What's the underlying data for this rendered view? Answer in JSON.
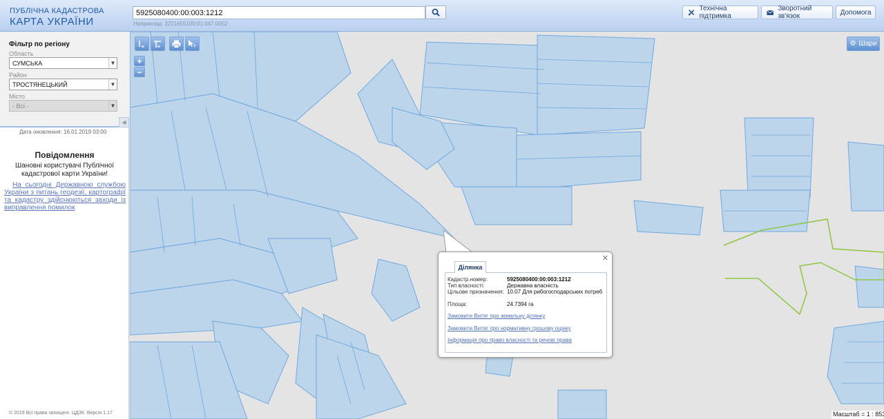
{
  "header": {
    "logo_line1": "ПУБЛІЧНА КАДАСТРОВА",
    "logo_line2": "КАРТА УКРАЇНИ",
    "search_value": "5925080400:00:003:1212",
    "search_hint": "Наприклад: 3221655100:01:047:0052",
    "buttons": {
      "support": "Технічна підтримка",
      "feedback": "Зворотний зв'язок",
      "help": "Допомога"
    }
  },
  "sidebar": {
    "filter_title": "Фільтр по регіону",
    "region_label": "Область",
    "region_value": "СУМСЬКА",
    "district_label": "Район",
    "district_value": "ТРОСТЯНЕЦЬКИЙ",
    "city_label": "Місто",
    "city_value": "- Всі -",
    "update_date": "Дата оновлення: 16.01.2019 03:00",
    "notice_title": "Повідомлення",
    "notice_greeting": "Шановні користувачі Публічної кадастрової карти України!",
    "notice_link": "На сьогодні Державною службою України з питань геодезії, картографії та кадастру здійснюються заходи із виправлення помилок",
    "copyright": "© 2016 Всі права захищені. ЦДЗК. Версія 1.17"
  },
  "map": {
    "layers_label": "Шари",
    "scale_text": "Масштаб = 1 : 8531",
    "tools": [
      "ruler",
      "area",
      "print",
      "identify"
    ],
    "colors": {
      "parcel_fill": "#bcd5ea",
      "parcel_stroke": "#6fa8e0",
      "highlight_stroke": "#8ec63f",
      "background": "#e4e4e4"
    }
  },
  "popup": {
    "tab_label": "Ділянка",
    "rows": [
      {
        "label": "Кадастр.номер:",
        "value": "5925080400:00:003:1212"
      },
      {
        "label": "Тип власності:",
        "value": "Державна власність"
      },
      {
        "label": "Цільове призначення:",
        "value": "10.07 Для рибогосподарських потреб"
      },
      {
        "label": "Площа:",
        "value": "24.7394 га"
      }
    ],
    "links": [
      "Замовити Витяг про земельну ділянку",
      "Замовити Витяг про нормативну грошову оцінку",
      "Інформація про право власності та речові права"
    ]
  }
}
